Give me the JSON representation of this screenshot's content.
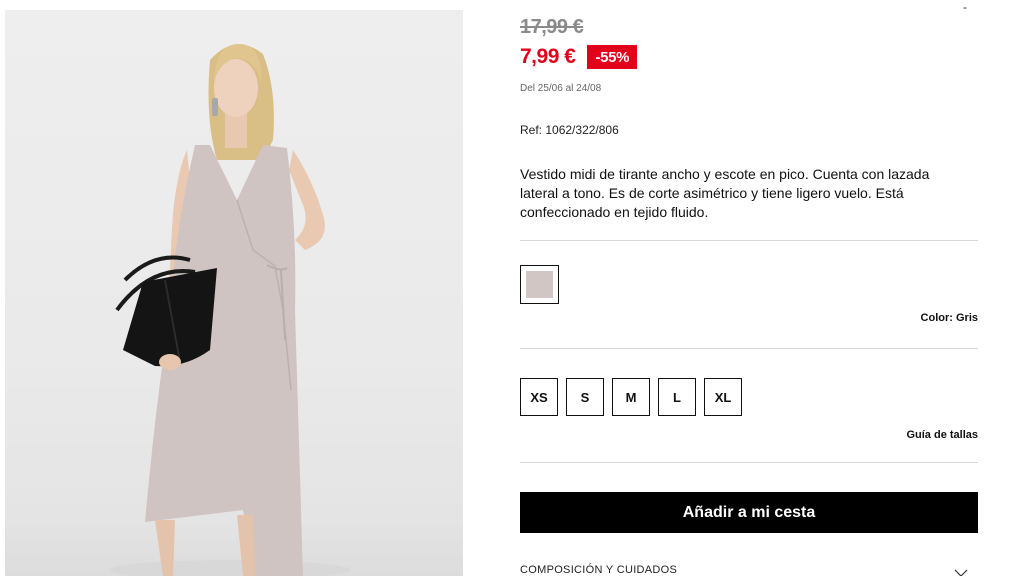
{
  "product": {
    "image_alt": "Vestido midi gris",
    "old_price": "17,99 €",
    "new_price": "7,99 €",
    "discount": "-55%",
    "promo_dates": "Del 25/06 al 24/08",
    "ref_label": "Ref:",
    "ref_value": "1062/322/806",
    "description": "Vestido midi de tirante ancho y escote en pico. Cuenta con lazada lateral a tono. Es de corte asimétrico y tiene ligero vuelo. Está confeccionado en tejido fluido."
  },
  "color": {
    "swatch_hex": "#d1c6c4",
    "label": "Color: Gris"
  },
  "sizes": [
    "XS",
    "S",
    "M",
    "L",
    "XL"
  ],
  "size_guide": "Guía de tallas",
  "add_to_cart": "Añadir a mi cesta",
  "accordion": {
    "title": "COMPOSICIÓN Y CUIDADOS",
    "icon": "chevron-down-icon"
  },
  "top_mark": "-",
  "colors": {
    "accent_red": "#e3001b",
    "button_black": "#000000"
  }
}
